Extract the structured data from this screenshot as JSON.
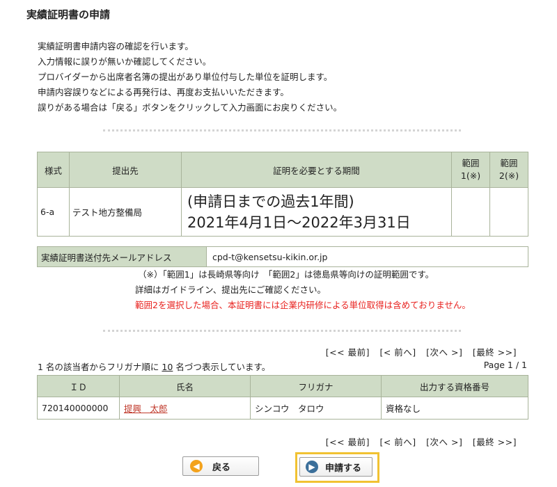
{
  "page_title": "実績証明書の申請",
  "intro_lines": [
    "実績証明書申請内容の確認を行います。",
    "入力情報に誤りが無いか確認してください。",
    "プロバイダーから出席者名簿の提出があり単位付与した単位を証明します。",
    "申請内容誤りなどによる再発行は、再度お支払いいただきます。",
    "誤りがある場合は「戻る」ボタンをクリックして入力画面にお戻りください。"
  ],
  "request_table": {
    "headers": [
      "様式",
      "提出先",
      "証明を必要とする期間",
      "範囲\n1(※)",
      "範囲\n2(※)"
    ],
    "row": {
      "form": "6-a",
      "destination": "テスト地方整備局",
      "period_line1": "(申請日までの過去1年間)",
      "period_line2": "2021年4月1日～2022年3月31日",
      "range1": "",
      "range2": ""
    }
  },
  "email": {
    "label": "実績証明書送付先メールアドレス",
    "value": "cpd-t@kensetsu-kikin.or.jp"
  },
  "notes": [
    "（※）「範囲1」は長崎県等向け　「範囲2」は徳島県等向けの証明範囲です。",
    "詳細はガイドライン、提出先にご確認ください。",
    "範囲2を選択した場合、本証明書には企業内研修による単位取得は含めておりません。"
  ],
  "pager": {
    "first": "[<< 最前]",
    "prev": "[< 前へ]",
    "next": "[次へ >]",
    "last": "[最終 >>]"
  },
  "results_summary": {
    "prefix": "1 名の該当者からフリガナ順に",
    "per_page": "10",
    "suffix": "名づつ表示しています。",
    "page_info": "Page 1 / 1"
  },
  "results_table": {
    "headers": [
      "ＩＤ",
      "氏名",
      "フリガナ",
      "出力する資格番号"
    ],
    "rows": [
      {
        "id": "720140000000",
        "name": "提興　太郎",
        "kana": "シンコウ　タロウ",
        "qualification": "資格なし"
      }
    ]
  },
  "buttons": {
    "back": "戻る",
    "apply": "申請する"
  },
  "colors": {
    "header_bg": "#cfdcc6",
    "border": "#a8b39a",
    "warning": "#e8211e",
    "highlight_frame": "#f1c232"
  }
}
